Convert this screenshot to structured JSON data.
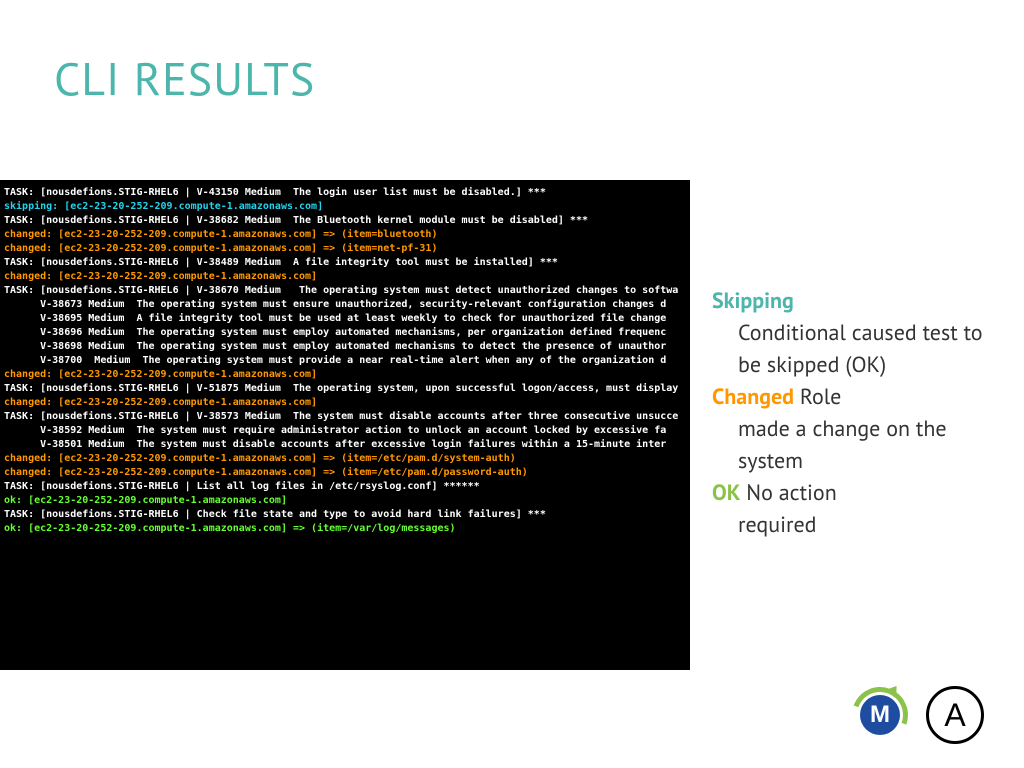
{
  "title": "CLI RESULTS",
  "colors": {
    "accent_teal": "#4db6ac",
    "status_changed": "#ff9800",
    "status_ok": "#8bc34a",
    "status_skipping": "#22d3ee"
  },
  "terminal": {
    "lines": [
      {
        "cls": "white",
        "text": "TASK: [nousdefions.STIG-RHEL6 | V-43150 Medium  The login user list must be disabled.] ***"
      },
      {
        "cls": "cyan",
        "text": "skipping: [ec2-23-20-252-209.compute-1.amazonaws.com]"
      },
      {
        "cls": "white",
        "text": ""
      },
      {
        "cls": "white",
        "text": "TASK: [nousdefions.STIG-RHEL6 | V-38682 Medium  The Bluetooth kernel module must be disabled] ***"
      },
      {
        "cls": "orange",
        "text": "changed: [ec2-23-20-252-209.compute-1.amazonaws.com] => (item=bluetooth)"
      },
      {
        "cls": "orange",
        "text": "changed: [ec2-23-20-252-209.compute-1.amazonaws.com] => (item=net-pf-31)"
      },
      {
        "cls": "white",
        "text": ""
      },
      {
        "cls": "white",
        "text": "TASK: [nousdefions.STIG-RHEL6 | V-38489 Medium  A file integrity tool must be installed] ***"
      },
      {
        "cls": "orange",
        "text": "changed: [ec2-23-20-252-209.compute-1.amazonaws.com]"
      },
      {
        "cls": "white",
        "text": ""
      },
      {
        "cls": "white",
        "text": "TASK: [nousdefions.STIG-RHEL6 | V-38670 Medium   The operating system must detect unauthorized changes to softwa"
      },
      {
        "cls": "white",
        "text": "      V-38673 Medium  The operating system must ensure unauthorized, security-relevant configuration changes d"
      },
      {
        "cls": "white",
        "text": "      V-38695 Medium  A file integrity tool must be used at least weekly to check for unauthorized file change"
      },
      {
        "cls": "white",
        "text": "      V-38696 Medium  The operating system must employ automated mechanisms, per organization defined frequenc"
      },
      {
        "cls": "white",
        "text": "      V-38698 Medium  The operating system must employ automated mechanisms to detect the presence of unauthor"
      },
      {
        "cls": "white",
        "text": "      V-38700  Medium  The operating system must provide a near real-time alert when any of the organization d"
      },
      {
        "cls": "orange",
        "text": "changed: [ec2-23-20-252-209.compute-1.amazonaws.com]"
      },
      {
        "cls": "white",
        "text": ""
      },
      {
        "cls": "white",
        "text": "TASK: [nousdefions.STIG-RHEL6 | V-51875 Medium  The operating system, upon successful logon/access, must display"
      },
      {
        "cls": "orange",
        "text": "changed: [ec2-23-20-252-209.compute-1.amazonaws.com]"
      },
      {
        "cls": "white",
        "text": ""
      },
      {
        "cls": "white",
        "text": "TASK: [nousdefions.STIG-RHEL6 | V-38573 Medium  The system must disable accounts after three consecutive unsucce"
      },
      {
        "cls": "white",
        "text": "      V-38592 Medium  The system must require administrator action to unlock an account locked by excessive fa"
      },
      {
        "cls": "white",
        "text": "      V-38501 Medium  The system must disable accounts after excessive login failures within a 15-minute inter"
      },
      {
        "cls": "orange",
        "text": "changed: [ec2-23-20-252-209.compute-1.amazonaws.com] => (item=/etc/pam.d/system-auth)"
      },
      {
        "cls": "orange",
        "text": "changed: [ec2-23-20-252-209.compute-1.amazonaws.com] => (item=/etc/pam.d/password-auth)"
      },
      {
        "cls": "white",
        "text": ""
      },
      {
        "cls": "white",
        "text": "TASK: [nousdefions.STIG-RHEL6 | List all log files in /etc/rsyslog.conf] ******"
      },
      {
        "cls": "lime",
        "text": "ok: [ec2-23-20-252-209.compute-1.amazonaws.com]"
      },
      {
        "cls": "white",
        "text": ""
      },
      {
        "cls": "white",
        "text": "TASK: [nousdefions.STIG-RHEL6 | Check file state and type to avoid hard link failures] ***"
      },
      {
        "cls": "lime",
        "text": "ok: [ec2-23-20-252-209.compute-1.amazonaws.com] => (item=/var/log/messages)"
      }
    ]
  },
  "legend": {
    "skipping": {
      "label": "Skipping",
      "desc": "Conditional caused test to be skipped (OK)"
    },
    "changed": {
      "label": "Changed",
      "desc_prefix": " Role",
      "desc_rest": "made a change on the system"
    },
    "ok": {
      "label": "OK",
      "desc_prefix": " No action",
      "desc_rest": "required"
    }
  },
  "logos": {
    "m_letter": "M",
    "a_letter": "A"
  }
}
